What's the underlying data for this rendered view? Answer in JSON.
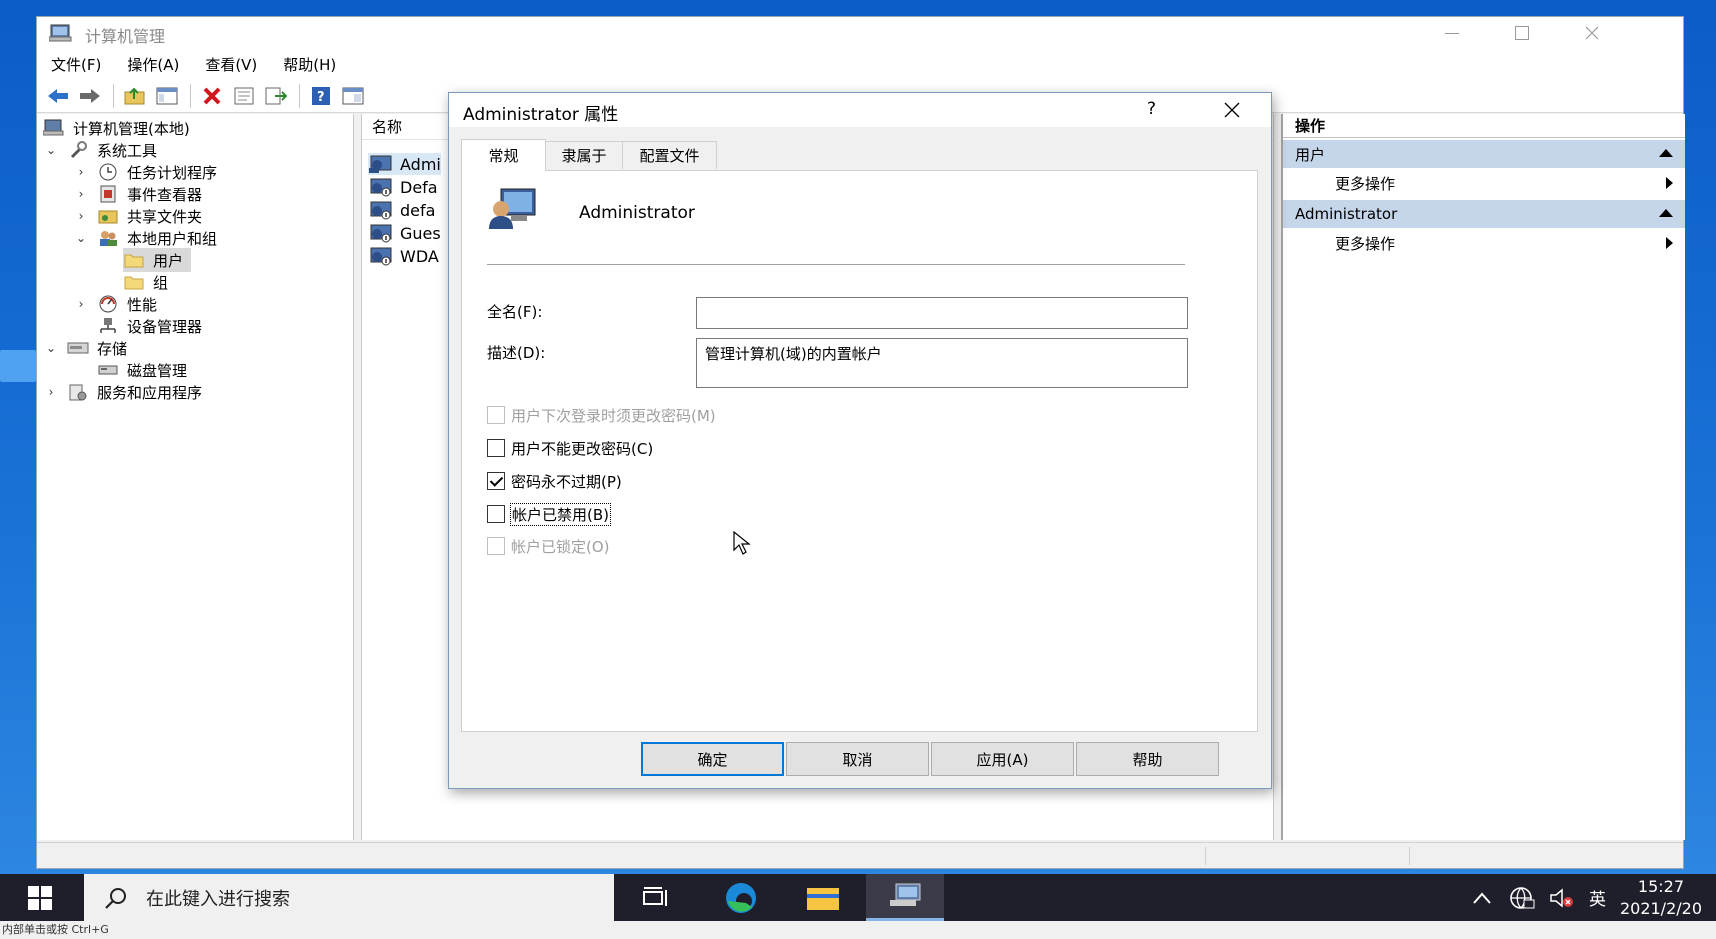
{
  "window": {
    "title": "计算机管理"
  },
  "menu": [
    "文件(F)",
    "操作(A)",
    "查看(V)",
    "帮助(H)"
  ],
  "tree": {
    "root": "计算机管理(本地)",
    "system_tools": "系统工具",
    "task_scheduler": "任务计划程序",
    "event_viewer": "事件查看器",
    "shared_folders": "共享文件夹",
    "local_users_groups": "本地用户和组",
    "users": "用户",
    "groups": "组",
    "performance": "性能",
    "device_manager": "设备管理器",
    "storage": "存储",
    "disk_management": "磁盘管理",
    "services_apps": "服务和应用程序"
  },
  "list": {
    "header_name": "名称",
    "rows": [
      "Admi",
      "Defa",
      "defa",
      "Gues",
      "WDA"
    ]
  },
  "actions": {
    "header": "操作",
    "group1": "用户",
    "group1_item": "更多操作",
    "group2": "Administrator",
    "group2_item": "更多操作"
  },
  "dialog": {
    "title": "Administrator 属性",
    "help_glyph": "?",
    "tabs": [
      "常规",
      "隶属于",
      "配置文件"
    ],
    "user_name": "Administrator",
    "fullname_label": "全名(F):",
    "fullname_value": "",
    "description_label": "描述(D):",
    "description_value": "管理计算机(域)的内置帐户",
    "checkboxes": {
      "must_change": {
        "label": "用户下次登录时须更改密码(M)",
        "checked": false,
        "enabled": false
      },
      "cannot_change": {
        "label": "用户不能更改密码(C)",
        "checked": false,
        "enabled": true
      },
      "never_expires": {
        "label": "密码永不过期(P)",
        "checked": true,
        "enabled": true
      },
      "disabled": {
        "label": "帐户已禁用(B)",
        "checked": false,
        "enabled": true
      },
      "locked": {
        "label": "帐户已锁定(O)",
        "checked": false,
        "enabled": false
      }
    },
    "buttons": {
      "ok": "确定",
      "cancel": "取消",
      "apply": "应用(A)",
      "help": "帮助"
    }
  },
  "taskbar": {
    "search_placeholder": "在此键入进行搜索",
    "ime": "英",
    "time": "15:27",
    "date": "2021/2/20"
  },
  "rdp_hint": "内部单击或按 Ctrl+G",
  "colors": {
    "accent": "#0078d7",
    "action_group": "#c6d6ea",
    "taskbar": "#1f1f2b"
  }
}
